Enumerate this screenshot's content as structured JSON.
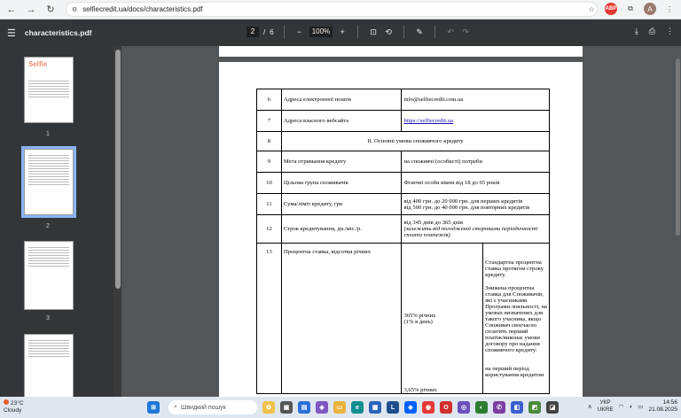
{
  "browser": {
    "url": "selfiecredit.ua/docs/characteristics.pdf",
    "ext_badge": "ABP",
    "avatar": "A"
  },
  "pdf": {
    "title": "characteristics.pdf",
    "current_page": "2",
    "total_pages": "6",
    "page_sep": "/",
    "zoom": "100%",
    "zoom_out": "−",
    "zoom_in": "+"
  },
  "thumbnails": [
    {
      "num": "1",
      "logo": "Selfie"
    },
    {
      "num": "2"
    },
    {
      "num": "3"
    }
  ],
  "table": {
    "rows": [
      {
        "num": "6",
        "label": "Адреса електронної пошти",
        "value": "info@selfiecredit.com.ua"
      },
      {
        "num": "7",
        "label": "Адреса власного вебсайта",
        "value": "https://selfiecredit.ua"
      },
      {
        "num": "8",
        "section": "ІІ. Основні умови споживчого кредиту"
      },
      {
        "num": "9",
        "label": "Мета отримання кредиту",
        "value": "на споживчі (особисті) потреби"
      },
      {
        "num": "10",
        "label": "Цільова група споживачів",
        "value": "Фізичні особи віком від 18 до 65 років"
      },
      {
        "num": "11",
        "label": "Сума/ліміт кредиту, грн",
        "value1": "від 400 грн. до 20 000 грн. для перших кредитів",
        "value2": "від 500 грн. до 40 000 грн. для повторних кредитів"
      },
      {
        "num": "12",
        "label": "Строк кредитування, дн./міс./р.",
        "value1": "від 345 днів до 365 днів",
        "value2": "(залежить від погодженої сторонами періодичності сплати платежів)"
      },
      {
        "num": "13",
        "label": "Процентна ставка, відсотки річних",
        "rate1": "365% річних",
        "rate1b": "(1% в день)",
        "rate2": "3,65% річних",
        "desc1": "Стандартна процентна ставка протягом строку кредиту.",
        "desc2": "Знижена процентна ставка для Споживачів, які є учасниками Програми лояльності, на умовах визначених для такого учасника, якщо Споживач своєчасно сплатить перший платіж/виконає умови договору про надання споживчого кредиту:",
        "desc3": "на перший період користування кредитом"
      }
    ]
  },
  "taskbar": {
    "temp": "23°C",
    "weather": "Cloudy",
    "search": "Швидкий пошук",
    "lang1": "УКР",
    "lang2": "UKRE",
    "time": "14:56",
    "date": "21.08.2025"
  }
}
